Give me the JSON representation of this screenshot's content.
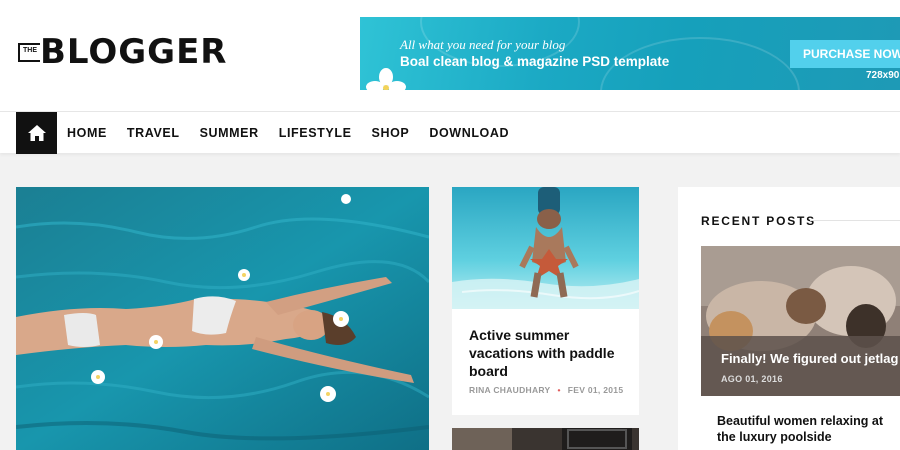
{
  "logo": {
    "prefix": "THE",
    "name": "BLOGGER"
  },
  "banner": {
    "tagline": "All what you need for your blog",
    "title": "Boal clean blog & magazine PSD template",
    "button_label": "PURCHASE NOW",
    "size_text": "728x90"
  },
  "nav": {
    "home_icon": "home-icon",
    "items": [
      "HOME",
      "TRAVEL",
      "SUMMER",
      "LIFESTYLE",
      "SHOP",
      "DOWNLOAD"
    ]
  },
  "small_card": {
    "title": "Active summer vacations with paddle board",
    "author": "RINA CHAUDHARY",
    "date": "FEV 01, 2015"
  },
  "sidebar": {
    "heading": "RECENT POSTS",
    "posts": [
      {
        "title": "Finally! We figured out jetlag",
        "date": "AGO 01, 2016"
      },
      {
        "title": "Beautiful women relaxing at the luxury poolside"
      }
    ]
  },
  "colors": {
    "accent": "#52d0ec",
    "banner": "#1ba9c4",
    "nav_home_bg": "#111111"
  }
}
